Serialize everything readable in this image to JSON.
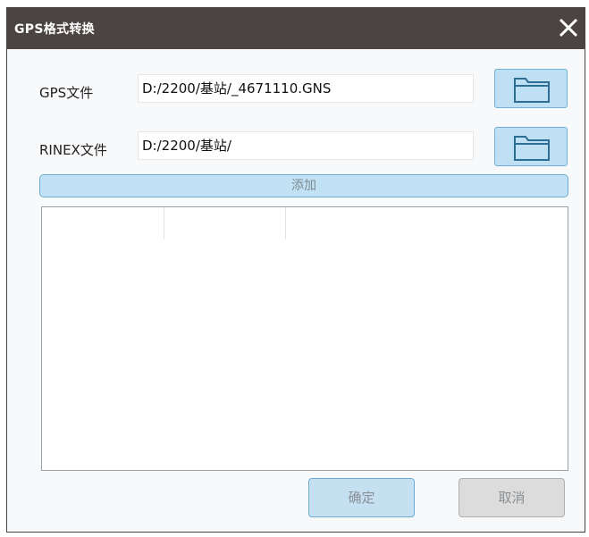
{
  "window": {
    "title": "GPS格式转换",
    "close_icon": "close-icon"
  },
  "gps": {
    "label": "GPS文件",
    "value": "D:/2200/基站/_4671110.GNS",
    "browse_icon": "folder-icon"
  },
  "rinex": {
    "label": "RINEX文件",
    "value": "D:/2200/基站/",
    "browse_icon": "folder-icon"
  },
  "add_label": "添加",
  "file_list": {
    "rows": []
  },
  "footer": {
    "ok_label": "确定",
    "cancel_label": "取消"
  },
  "colors": {
    "titlebar": "#4b4442",
    "button_blue": "#c1e1f4",
    "button_border": "#67acd6"
  }
}
